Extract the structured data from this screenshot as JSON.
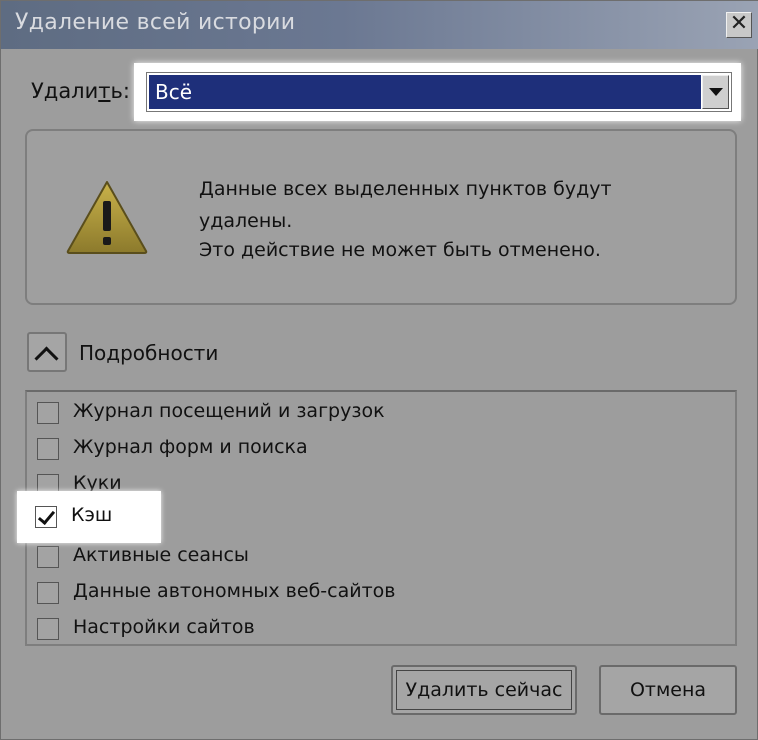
{
  "window": {
    "title": "Удаление всей истории",
    "close_label": "✕"
  },
  "delete_row": {
    "label_prefix": "Удали",
    "label_underlined": "т",
    "label_suffix": "ь:",
    "selected_value": "Всё"
  },
  "warning": {
    "icon": "warning-triangle-icon",
    "line1": "Данные всех выделенных пунктов будут удалены.",
    "line2": "Это действие не может быть отменено."
  },
  "details": {
    "label_prefix": "По",
    "label_underlined": "д",
    "label_suffix": "робности"
  },
  "items": [
    {
      "label": "Журнал посещений и загрузок",
      "checked": false
    },
    {
      "label": "Журнал форм и поиска",
      "checked": false
    },
    {
      "label": "Куки",
      "checked": false
    },
    {
      "label": "Кэш",
      "checked": true
    },
    {
      "label": "Активные сеансы",
      "checked": false
    },
    {
      "label": "Данные автономных веб-сайтов",
      "checked": false
    },
    {
      "label": "Настройки сайтов",
      "checked": false
    }
  ],
  "buttons": {
    "delete_now": "Удалить сейчас",
    "cancel": "Отмена"
  },
  "colors": {
    "selection": "#1e2f7a",
    "highlight": "#ffffff"
  }
}
